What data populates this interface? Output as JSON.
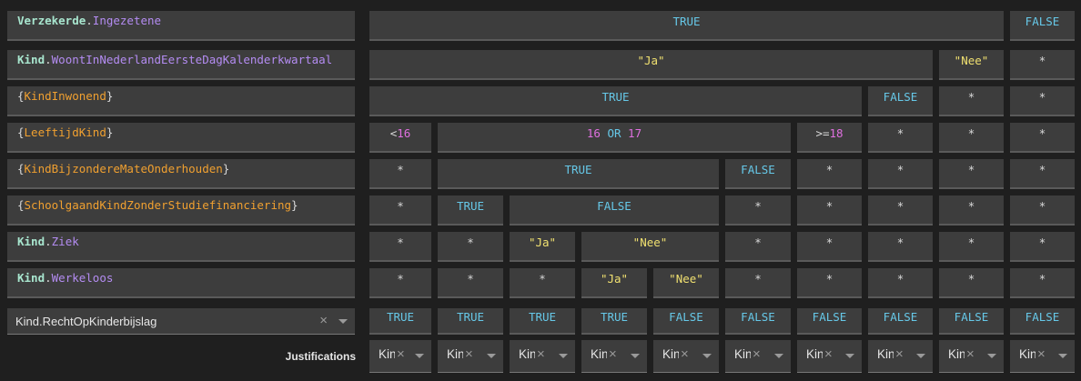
{
  "conditions": [
    {
      "parts": [
        {
          "t": "Verzekerde",
          "c": "obj"
        },
        {
          "t": ".",
          "c": "dot"
        },
        {
          "t": "Ingezetene",
          "c": "prop"
        }
      ]
    },
    {
      "parts": [
        {
          "t": "Kind",
          "c": "obj"
        },
        {
          "t": ".",
          "c": "dot"
        },
        {
          "t": "WoontInNederlandEersteDagKalenderkwartaal",
          "c": "prop"
        }
      ]
    },
    {
      "parts": [
        {
          "t": "{",
          "c": "brace"
        },
        {
          "t": "KindInwonend",
          "c": "var"
        },
        {
          "t": "}",
          "c": "brace"
        }
      ]
    },
    {
      "parts": [
        {
          "t": "{",
          "c": "brace"
        },
        {
          "t": "LeeftijdKind",
          "c": "var"
        },
        {
          "t": "}",
          "c": "brace"
        }
      ]
    },
    {
      "parts": [
        {
          "t": "{",
          "c": "brace"
        },
        {
          "t": "KindBijzondereMateOnderhouden",
          "c": "var"
        },
        {
          "t": "}",
          "c": "brace"
        }
      ]
    },
    {
      "parts": [
        {
          "t": "{",
          "c": "brace"
        },
        {
          "t": "SchoolgaandKindZonderStudiefinanciering",
          "c": "var"
        },
        {
          "t": "}",
          "c": "brace"
        }
      ]
    },
    {
      "parts": [
        {
          "t": "Kind",
          "c": "obj"
        },
        {
          "t": ".",
          "c": "dot"
        },
        {
          "t": "Ziek",
          "c": "prop"
        }
      ]
    },
    {
      "parts": [
        {
          "t": "Kind",
          "c": "obj"
        },
        {
          "t": ".",
          "c": "dot"
        },
        {
          "t": "Werkeloos",
          "c": "prop"
        }
      ]
    }
  ],
  "rows": [
    [
      {
        "span": [
          0,
          8
        ],
        "parts": [
          {
            "t": "TRUE",
            "c": "bool"
          }
        ]
      },
      {
        "span": [
          9,
          9
        ],
        "parts": [
          {
            "t": "FALSE",
            "c": "bool"
          }
        ]
      }
    ],
    [
      {
        "span": [
          0,
          7
        ],
        "parts": [
          {
            "t": "\"Ja\"",
            "c": "str"
          }
        ]
      },
      {
        "span": [
          8,
          8
        ],
        "parts": [
          {
            "t": "\"Nee\"",
            "c": "str"
          }
        ]
      },
      {
        "span": [
          9,
          9
        ],
        "parts": [
          {
            "t": "*",
            "c": "star"
          }
        ]
      }
    ],
    [
      {
        "span": [
          0,
          6
        ],
        "parts": [
          {
            "t": "TRUE",
            "c": "bool"
          }
        ]
      },
      {
        "span": [
          7,
          7
        ],
        "parts": [
          {
            "t": "FALSE",
            "c": "bool"
          }
        ]
      },
      {
        "span": [
          8,
          8
        ],
        "parts": [
          {
            "t": "*",
            "c": "star"
          }
        ]
      },
      {
        "span": [
          9,
          9
        ],
        "parts": [
          {
            "t": "*",
            "c": "star"
          }
        ]
      }
    ],
    [
      {
        "span": [
          0,
          0
        ],
        "parts": [
          {
            "t": "<",
            "c": "op"
          },
          {
            "t": "16",
            "c": "num"
          }
        ]
      },
      {
        "span": [
          1,
          5
        ],
        "parts": [
          {
            "t": "16",
            "c": "num"
          },
          {
            "t": " OR ",
            "c": "kw"
          },
          {
            "t": "17",
            "c": "num"
          }
        ]
      },
      {
        "span": [
          6,
          6
        ],
        "parts": [
          {
            "t": ">=",
            "c": "op"
          },
          {
            "t": "18",
            "c": "num"
          }
        ]
      },
      {
        "span": [
          7,
          7
        ],
        "parts": [
          {
            "t": "*",
            "c": "star"
          }
        ]
      },
      {
        "span": [
          8,
          8
        ],
        "parts": [
          {
            "t": "*",
            "c": "star"
          }
        ]
      },
      {
        "span": [
          9,
          9
        ],
        "parts": [
          {
            "t": "*",
            "c": "star"
          }
        ]
      }
    ],
    [
      {
        "span": [
          0,
          0
        ],
        "parts": [
          {
            "t": "*",
            "c": "star"
          }
        ]
      },
      {
        "span": [
          1,
          4
        ],
        "parts": [
          {
            "t": "TRUE",
            "c": "bool"
          }
        ]
      },
      {
        "span": [
          5,
          5
        ],
        "parts": [
          {
            "t": "FALSE",
            "c": "bool"
          }
        ]
      },
      {
        "span": [
          6,
          6
        ],
        "parts": [
          {
            "t": "*",
            "c": "star"
          }
        ]
      },
      {
        "span": [
          7,
          7
        ],
        "parts": [
          {
            "t": "*",
            "c": "star"
          }
        ]
      },
      {
        "span": [
          8,
          8
        ],
        "parts": [
          {
            "t": "*",
            "c": "star"
          }
        ]
      },
      {
        "span": [
          9,
          9
        ],
        "parts": [
          {
            "t": "*",
            "c": "star"
          }
        ]
      }
    ],
    [
      {
        "span": [
          0,
          0
        ],
        "parts": [
          {
            "t": "*",
            "c": "star"
          }
        ]
      },
      {
        "span": [
          1,
          1
        ],
        "parts": [
          {
            "t": "TRUE",
            "c": "bool"
          }
        ]
      },
      {
        "span": [
          2,
          4
        ],
        "parts": [
          {
            "t": "FALSE",
            "c": "bool"
          }
        ]
      },
      {
        "span": [
          5,
          5
        ],
        "parts": [
          {
            "t": "*",
            "c": "star"
          }
        ]
      },
      {
        "span": [
          6,
          6
        ],
        "parts": [
          {
            "t": "*",
            "c": "star"
          }
        ]
      },
      {
        "span": [
          7,
          7
        ],
        "parts": [
          {
            "t": "*",
            "c": "star"
          }
        ]
      },
      {
        "span": [
          8,
          8
        ],
        "parts": [
          {
            "t": "*",
            "c": "star"
          }
        ]
      },
      {
        "span": [
          9,
          9
        ],
        "parts": [
          {
            "t": "*",
            "c": "star"
          }
        ]
      }
    ],
    [
      {
        "span": [
          0,
          0
        ],
        "parts": [
          {
            "t": "*",
            "c": "star"
          }
        ]
      },
      {
        "span": [
          1,
          1
        ],
        "parts": [
          {
            "t": "*",
            "c": "star"
          }
        ]
      },
      {
        "span": [
          2,
          2
        ],
        "parts": [
          {
            "t": "\"Ja\"",
            "c": "str"
          }
        ]
      },
      {
        "span": [
          3,
          4
        ],
        "parts": [
          {
            "t": "\"Nee\"",
            "c": "str"
          }
        ]
      },
      {
        "span": [
          5,
          5
        ],
        "parts": [
          {
            "t": "*",
            "c": "star"
          }
        ]
      },
      {
        "span": [
          6,
          6
        ],
        "parts": [
          {
            "t": "*",
            "c": "star"
          }
        ]
      },
      {
        "span": [
          7,
          7
        ],
        "parts": [
          {
            "t": "*",
            "c": "star"
          }
        ]
      },
      {
        "span": [
          8,
          8
        ],
        "parts": [
          {
            "t": "*",
            "c": "star"
          }
        ]
      },
      {
        "span": [
          9,
          9
        ],
        "parts": [
          {
            "t": "*",
            "c": "star"
          }
        ]
      }
    ],
    [
      {
        "span": [
          0,
          0
        ],
        "parts": [
          {
            "t": "*",
            "c": "star"
          }
        ]
      },
      {
        "span": [
          1,
          1
        ],
        "parts": [
          {
            "t": "*",
            "c": "star"
          }
        ]
      },
      {
        "span": [
          2,
          2
        ],
        "parts": [
          {
            "t": "*",
            "c": "star"
          }
        ]
      },
      {
        "span": [
          3,
          3
        ],
        "parts": [
          {
            "t": "\"Ja\"",
            "c": "str"
          }
        ]
      },
      {
        "span": [
          4,
          4
        ],
        "parts": [
          {
            "t": "\"Nee\"",
            "c": "str"
          }
        ]
      },
      {
        "span": [
          5,
          5
        ],
        "parts": [
          {
            "t": "*",
            "c": "star"
          }
        ]
      },
      {
        "span": [
          6,
          6
        ],
        "parts": [
          {
            "t": "*",
            "c": "star"
          }
        ]
      },
      {
        "span": [
          7,
          7
        ],
        "parts": [
          {
            "t": "*",
            "c": "star"
          }
        ]
      },
      {
        "span": [
          8,
          8
        ],
        "parts": [
          {
            "t": "*",
            "c": "star"
          }
        ]
      },
      {
        "span": [
          9,
          9
        ],
        "parts": [
          {
            "t": "*",
            "c": "star"
          }
        ]
      }
    ]
  ],
  "conclusion": {
    "label": "Kind.RechtOpKinderbijslag",
    "clear_glyph": "×",
    "values": [
      "TRUE",
      "TRUE",
      "TRUE",
      "TRUE",
      "FALSE",
      "FALSE",
      "FALSE",
      "FALSE",
      "FALSE",
      "FALSE"
    ]
  },
  "justifications": {
    "label": "Justifications",
    "values": [
      "Kin",
      "Kin",
      "Kin",
      "Kin",
      "Kin",
      "Kin",
      "Kin",
      "Kin",
      "Kin",
      "Kin"
    ],
    "clear_glyph": "×"
  }
}
